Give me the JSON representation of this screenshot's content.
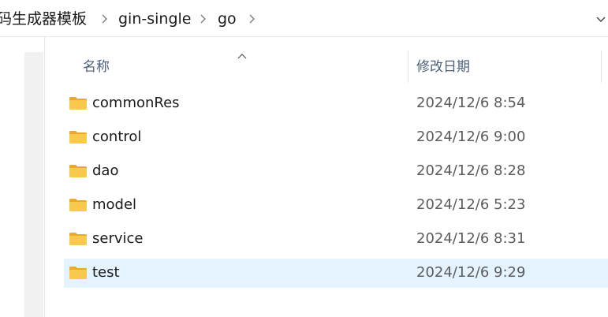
{
  "breadcrumb": {
    "items": [
      "码生成器模板",
      "gin-single",
      "go"
    ]
  },
  "columns": {
    "name": "名称",
    "date_modified": "修改日期"
  },
  "files": [
    {
      "name": "commonRes",
      "modified": "2024/12/6 8:54",
      "type": "folder",
      "selected": false
    },
    {
      "name": "control",
      "modified": "2024/12/6 9:00",
      "type": "folder",
      "selected": false
    },
    {
      "name": "dao",
      "modified": "2024/12/6 8:28",
      "type": "folder",
      "selected": false
    },
    {
      "name": "model",
      "modified": "2024/12/6 5:23",
      "type": "folder",
      "selected": false
    },
    {
      "name": "service",
      "modified": "2024/12/6 8:31",
      "type": "folder",
      "selected": false
    },
    {
      "name": "test",
      "modified": "2024/12/6 9:29",
      "type": "folder",
      "selected": true
    }
  ],
  "colors": {
    "selected_row": "#e5f3ff",
    "folder_yellow": "#f8c94a",
    "header_text": "#4c607a"
  }
}
